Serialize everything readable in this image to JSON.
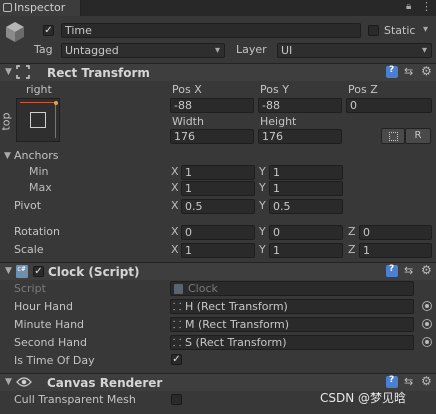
{
  "window": {
    "tab_label": "Inspector"
  },
  "gameobject": {
    "active": true,
    "name": "Time",
    "static_label": "Static",
    "tag_label": "Tag",
    "tag_value": "Untagged",
    "layer_label": "Layer",
    "layer_value": "UI"
  },
  "rect_transform": {
    "title": "Rect Transform",
    "anchor_preset_h": "right",
    "anchor_preset_v": "top",
    "pos_x_label": "Pos X",
    "pos_y_label": "Pos Y",
    "pos_z_label": "Pos Z",
    "pos_x": "-88",
    "pos_y": "-88",
    "pos_z": "0",
    "width_label": "Width",
    "height_label": "Height",
    "width": "176",
    "height": "176",
    "r_button": "R",
    "anchors_label": "Anchors",
    "min_label": "Min",
    "max_label": "Max",
    "min_x": "1",
    "min_y": "1",
    "max_x": "1",
    "max_y": "1",
    "pivot_label": "Pivot",
    "pivot_x": "0.5",
    "pivot_y": "0.5",
    "rotation_label": "Rotation",
    "rot_x": "0",
    "rot_y": "0",
    "rot_z": "0",
    "scale_label": "Scale",
    "scale_x": "1",
    "scale_y": "1",
    "scale_z": "1",
    "axis_x": "X",
    "axis_y": "Y",
    "axis_z": "Z"
  },
  "clock_script": {
    "enabled": true,
    "title": "Clock (Script)",
    "script_label": "Script",
    "script_value": "Clock",
    "hour_label": "Hour Hand",
    "hour_value": "H (Rect Transform)",
    "minute_label": "Minute Hand",
    "minute_value": "M (Rect Transform)",
    "second_label": "Second Hand",
    "second_value": "S (Rect Transform)",
    "time_of_day_label": "Is Time Of Day",
    "time_of_day": true
  },
  "canvas_renderer": {
    "title": "Canvas Renderer",
    "cull_label": "Cull Transparent Mesh",
    "cull_value": false
  },
  "watermark": "CSDN @梦见晗",
  "colors": {
    "background": "#383838",
    "field": "#2a2a2a",
    "header": "#3e3e3e",
    "accent_blue": "#4a7fd1",
    "script_icon": "#6d8fb0"
  }
}
